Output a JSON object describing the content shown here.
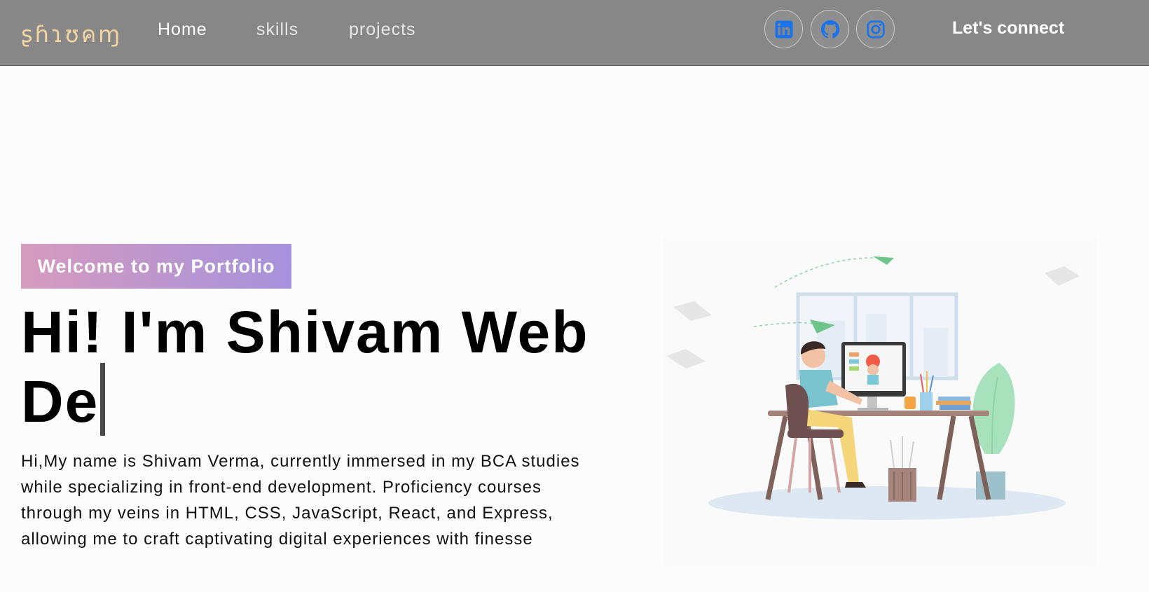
{
  "navbar": {
    "logo": "ʂɦɿʊคɱ",
    "links": [
      "Home",
      "skills",
      "projects"
    ],
    "social": [
      {
        "icon": "linkedin-icon",
        "color": "#1a73e8"
      },
      {
        "icon": "github-icon",
        "color": "#1a73e8"
      },
      {
        "icon": "instagram-icon",
        "color": "#1a73e8"
      }
    ],
    "connect_label": "Let's connect"
  },
  "hero": {
    "tagline": "Welcome to my Portfolio",
    "headline": "Hi! I'm Shivam Web De",
    "intro": "Hi,My name is Shivam Verma, currently immersed in my BCA studies while specializing in front-end development. Proficiency courses through my veins in HTML, CSS, JavaScript, React, and Express, allowing me to craft captivating digital experiences with finesse"
  },
  "colors": {
    "navbar_bg": "#878787",
    "logo": "#f3d3a2",
    "tagline_gradient_start": "#d59bbe",
    "tagline_gradient_end": "#a692dc",
    "icon_blue": "#1a73e8"
  }
}
